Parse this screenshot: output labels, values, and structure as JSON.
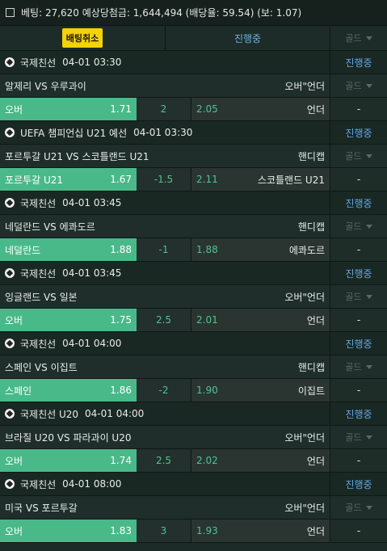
{
  "summary": "베팅: 27,620 예상당첨금: 1,644,494 (배당율: 59.54) (보: 1.07)",
  "cancel_label": "배팅취소",
  "progress_label": "진행중",
  "gold_label": "골드",
  "games": [
    {
      "league": "국제친선",
      "time": "04-01 03:30",
      "status": "진행중",
      "match": "알제리 VS 우루과이",
      "market": "오버\"언더",
      "home": "오버",
      "home_odd": "1.71",
      "line": "2",
      "away_odd": "2.05",
      "away": "언더",
      "extra": "-"
    },
    {
      "league": "UEFA 챔피언십 U21 예선",
      "time": "04-01 03:30",
      "status": "진행중",
      "match": "포르투갈 U21 VS 스코틀랜드 U21",
      "market": "핸디캡",
      "home": "포르투갈 U21",
      "home_odd": "1.67",
      "line": "-1.5",
      "away_odd": "2.11",
      "away": "스코틀랜드 U21",
      "extra": "-"
    },
    {
      "league": "국제친선",
      "time": "04-01 03:45",
      "status": "진행중",
      "match": "네덜란드 VS 에콰도르",
      "market": "핸디캡",
      "home": "네덜란드",
      "home_odd": "1.88",
      "line": "-1",
      "away_odd": "1.88",
      "away": "에콰도르",
      "extra": "-"
    },
    {
      "league": "국제친선",
      "time": "04-01 03:45",
      "status": "진행중",
      "match": "잉글랜드 VS 일본",
      "market": "오버\"언더",
      "home": "오버",
      "home_odd": "1.75",
      "line": "2.5",
      "away_odd": "2.01",
      "away": "언더",
      "extra": "-"
    },
    {
      "league": "국제친선",
      "time": "04-01 04:00",
      "status": "진행중",
      "match": "스페인 VS 이집트",
      "market": "핸디캡",
      "home": "스페인",
      "home_odd": "1.86",
      "line": "-2",
      "away_odd": "1.90",
      "away": "이집트",
      "extra": "-"
    },
    {
      "league": "국제친선 U20",
      "time": "04-01 04:00",
      "status": "진행중",
      "match": "브라질 U20 VS 파라과이 U20",
      "market": "오버\"언더",
      "home": "오버",
      "home_odd": "1.74",
      "line": "2.5",
      "away_odd": "2.02",
      "away": "언더",
      "extra": "-"
    },
    {
      "league": "국제친선",
      "time": "04-01 08:00",
      "status": "진행중",
      "match": "미국 VS 포르투갈",
      "market": "오버\"언더",
      "home": "오버",
      "home_odd": "1.83",
      "line": "3",
      "away_odd": "1.93",
      "away": "언더",
      "extra": "-"
    }
  ]
}
